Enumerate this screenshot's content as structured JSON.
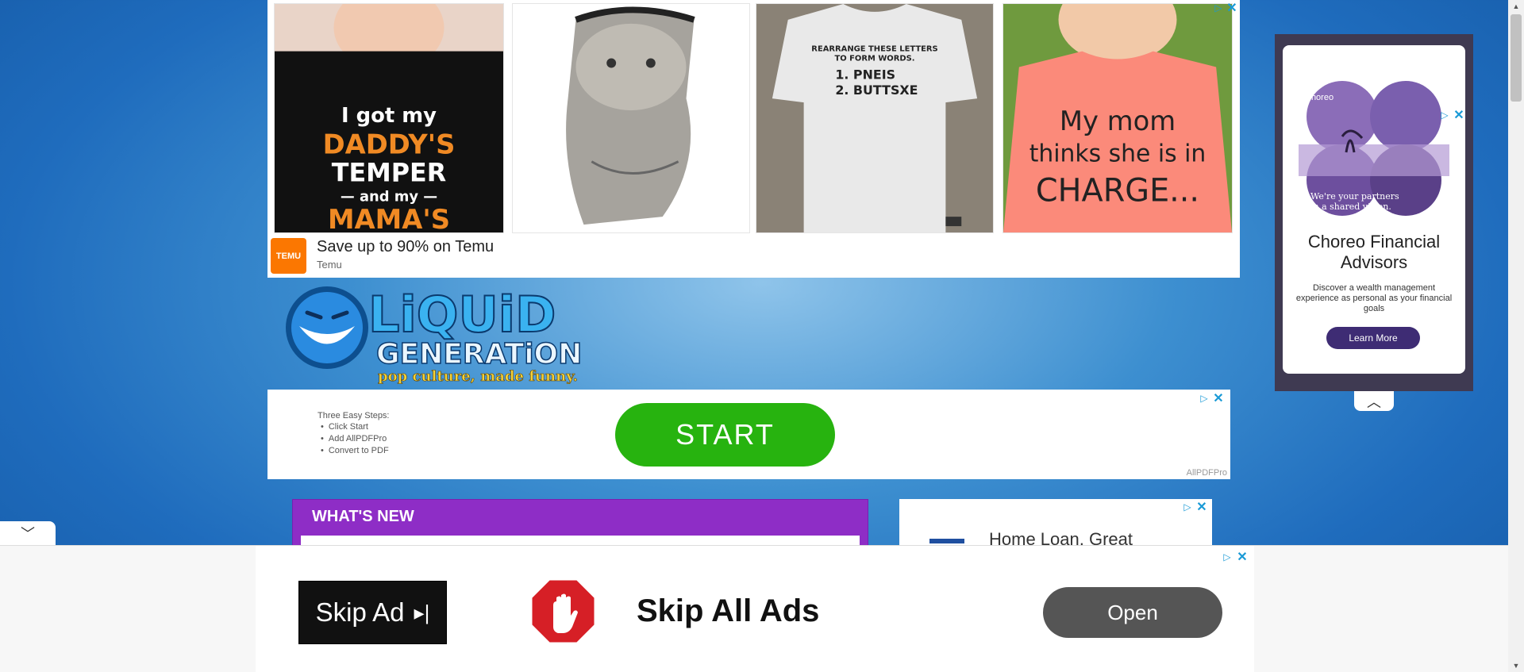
{
  "temu_ad": {
    "headline": "Save up to 90% on Temu",
    "advertiser": "Temu",
    "logo_text": "TEMU",
    "products": [
      {
        "alt": "I got my DADDY'S TEMPER and my MAMA'S"
      },
      {
        "alt": "cat face mask"
      },
      {
        "alt": "REARRANGE THESE LETTERS TO FORM WORDS. 1. PNEIS 2. BUTTSXE"
      },
      {
        "alt": "My mom thinks she is in CHARGE..."
      }
    ]
  },
  "site": {
    "logo_line1": "LiQUiD",
    "logo_line2": "GENERATiON",
    "tagline": "pop culture, made funny."
  },
  "pdf_ad": {
    "steps_title": "Three Easy Steps:",
    "steps": [
      "Click Start",
      "Add AllPDFPro",
      "Convert to PDF"
    ],
    "cta": "START",
    "brand": "AllPDFPro"
  },
  "whats_new": {
    "title": "WHAT'S NEW"
  },
  "loan_ad": {
    "text": "Home Loan, Great"
  },
  "side_ad": {
    "brand": "Choreo",
    "image_text": "We're your partners in a shared vision.",
    "name": "Choreo Financial Advisors",
    "description": "Discover a wealth management experience as personal as your financial goals",
    "cta": "Learn More"
  },
  "bottom_ad": {
    "skip_ad_label": "Skip Ad",
    "title": "Skip All Ads",
    "cta": "Open"
  },
  "icons": {
    "adchoices": "adchoices-icon",
    "close": "close-icon",
    "collapse": "chevron-up-icon",
    "expand": "chevron-down-icon"
  }
}
